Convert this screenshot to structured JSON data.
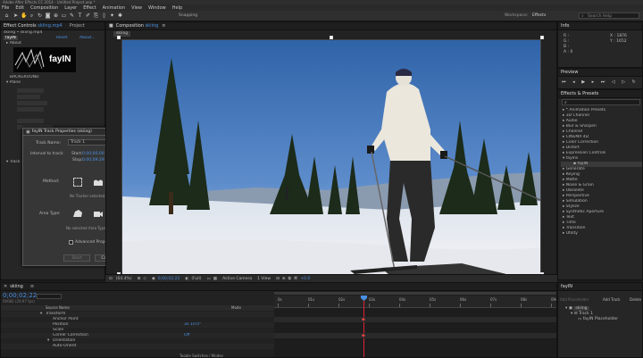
{
  "window": {
    "title": "Adobe After Effects CC 2014 - Untitled Project.aep *"
  },
  "menu": [
    "File",
    "Edit",
    "Composition",
    "Layer",
    "Effect",
    "Animation",
    "View",
    "Window",
    "Help"
  ],
  "toolbar": {
    "snapping": "Snapping",
    "workspace_label": "Workspace:",
    "workspace_value": "Effects",
    "search_placeholder": "Search Help"
  },
  "left_panel": {
    "tab_effect_controls": "Effect Controls",
    "tab_effect_controls_target": "skiing.mp4",
    "tab_project": "Project",
    "breadcrumb": "skiing • skiing.mp4",
    "effect_name": "fayIN",
    "reset": "Reset",
    "about": "About...",
    "about_row": "About",
    "logo_text": "fayIN",
    "background": "BACKGROUND",
    "plane": "Plane",
    "track": "Track 1"
  },
  "track_dialog": {
    "title": "fayIN Track Properties (skiing)",
    "track_name_label": "Track Name:",
    "track_name_value": "Track 1",
    "interval_label": "Interval to track:",
    "start_label": "Start:",
    "start_value": "0;00;00;00",
    "stop_label": "Stop:",
    "stop_value": "0;00;09;29",
    "method_label": "Method:",
    "no_tracker": "No Tracker selected",
    "area_type_label": "Area Type:",
    "no_area": "No selected Area Type",
    "advanced": "Advanced Properties",
    "start_btn": "Start",
    "cancel_btn": "Cancel"
  },
  "composition": {
    "tab": "Composition",
    "tab_name": "skiing",
    "badge": "skiing",
    "zoom": "(64.4%)",
    "timecode": "0;00;02;22",
    "resolution": "(Full)",
    "camera": "Active Camera",
    "view": "1 View",
    "offset": "+0.0"
  },
  "info": {
    "tab": "Info",
    "x": "X : 1876",
    "y": "Y : 1652",
    "r": "R :",
    "g": "G :",
    "b": "B :",
    "a": "A : 0"
  },
  "preview": {
    "tab": "Preview"
  },
  "effects_presets": {
    "tab": "Effects & Presets",
    "search_placeholder": "",
    "items": [
      "* Animation Presets",
      "3D Channel",
      "Audio",
      "Blur & Sharpen",
      "Channel",
      "CINEMA 4D",
      "Color Correction",
      "Distort",
      "Expression Controls",
      "fayIns",
      "fayIN",
      "Generate",
      "Keying",
      "Matte",
      "Noise & Grain",
      "Obsolete",
      "Perspective",
      "Simulation",
      "Stylize",
      "Synthetic Aperture",
      "Text",
      "Time",
      "Transition",
      "Utility"
    ]
  },
  "fayin_panel": {
    "tab": "fayIN",
    "placeholder_btn": "Add Placeholder",
    "add_track": "Add Track",
    "delete": "Delete",
    "tree_root": "skiing",
    "tree_track": "Track 1",
    "tree_placeholder": "fayIN Placeholder"
  },
  "timeline": {
    "tab": "skiing",
    "timecode": "0;00;02;22",
    "fps": "00082 (29.97 fps)",
    "col_source": "Source Name",
    "col_mode": "Mode",
    "rows": [
      "Transform",
      "Anchor Point",
      "Position",
      "Scale",
      "Corner Correction",
      "Orientation",
      "Auto-Orient"
    ],
    "values": [
      "",
      "",
      "3x 10.0°",
      "",
      "Off",
      "",
      ""
    ],
    "ruler": [
      "0s",
      "01s",
      "02s",
      "03s",
      "04s",
      "05s",
      "06s",
      "07s",
      "08s",
      "09s"
    ],
    "footer": "Toggle Switches / Modes"
  }
}
